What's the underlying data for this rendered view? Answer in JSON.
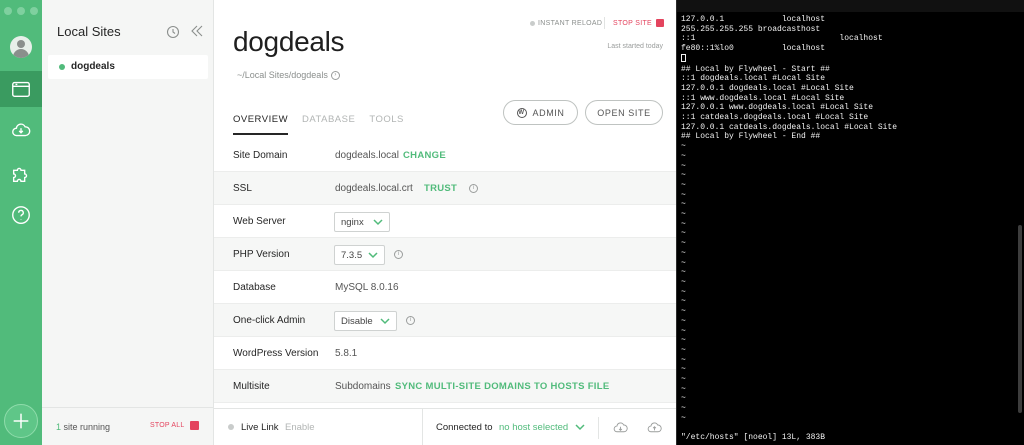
{
  "colors": {
    "accent": "#51bb7b",
    "danger": "#e4445e",
    "terminal_bg": "#000000"
  },
  "rail": {
    "icons": [
      "avatar",
      "sites-icon",
      "cloud-icon",
      "addons-icon",
      "help-icon",
      "add-site-icon"
    ]
  },
  "sites": {
    "title": "Local Sites",
    "items": [
      {
        "name": "dogdeals",
        "status": "running"
      }
    ],
    "footer": {
      "running_count": "1",
      "running_label": "site running",
      "stop_all": "STOP ALL"
    }
  },
  "main": {
    "instant_reload": "INSTANT RELOAD",
    "stop_site": "STOP SITE",
    "last_started": "Last started today",
    "site_title": "dogdeals",
    "site_path": "~/Local Sites/dogdeals",
    "tabs": [
      {
        "label": "OVERVIEW",
        "active": true
      },
      {
        "label": "DATABASE"
      },
      {
        "label": "TOOLS"
      }
    ],
    "admin_button": "ADMIN",
    "open_site_button": "OPEN SITE",
    "rows": {
      "site_domain": {
        "label": "Site Domain",
        "value": "dogdeals.local",
        "action": "CHANGE"
      },
      "ssl": {
        "label": "SSL",
        "value": "dogdeals.local.crt",
        "action": "TRUST"
      },
      "web_server": {
        "label": "Web Server",
        "value": "nginx"
      },
      "php_version": {
        "label": "PHP Version",
        "value": "7.3.5"
      },
      "database": {
        "label": "Database",
        "value": "MySQL 8.0.16"
      },
      "one_click_admin": {
        "label": "One-click Admin",
        "value": "Disable"
      },
      "wp_version": {
        "label": "WordPress Version",
        "value": "5.8.1"
      },
      "multisite": {
        "label": "Multisite",
        "value": "Subdomains",
        "action": "SYNC MULTI-SITE DOMAINS TO HOSTS FILE"
      }
    },
    "footer": {
      "live_link": "Live Link",
      "enable": "Enable",
      "connected_to": "Connected to",
      "host": "no host selected"
    }
  },
  "terminal": {
    "lines": [
      "127.0.0.1            localhost",
      "255.255.255.255 broadcasthost",
      "::1                              localhost",
      "fe80::1%lo0          localhost",
      "",
      "## Local by Flywheel - Start ##",
      "::1 dogdeals.local #Local Site",
      "127.0.0.1 dogdeals.local #Local Site",
      "::1 www.dogdeals.local #Local Site",
      "127.0.0.1 www.dogdeals.local #Local Site",
      "::1 catdeals.dogdeals.local #Local Site",
      "127.0.0.1 catdeals.dogdeals.local #Local Site",
      "## Local by Flywheel - End ##"
    ],
    "tilde": "~",
    "tilde_count": 29,
    "status": "\"/etc/hosts\" [noeol] 13L, 383B"
  }
}
